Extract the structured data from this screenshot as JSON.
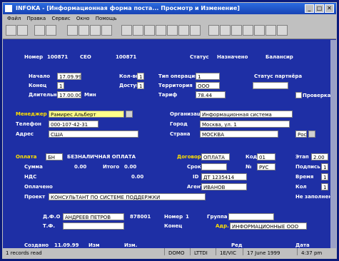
{
  "window": {
    "title": "INFOKA - [Информационная форма поста... Просмотр и Изменение]"
  },
  "menu": [
    "Файл",
    "Правка",
    "Сервис",
    "Окно",
    "Помощь"
  ],
  "header": {
    "label1": "Номер",
    "value1": "100871",
    "label2": "СЕО",
    "value2": "100871",
    "status_label": "Статус",
    "status_value": "Назначено",
    "right_label": "Балансир"
  },
  "form": {
    "left_labels": [
      "Начало",
      "Конец",
      "Длительность"
    ],
    "left_values": [
      "17.09.99",
      "1",
      "17.00.00"
    ],
    "unit": "Мин",
    "mid_labels": [
      "Кол-во",
      "Доступ"
    ],
    "mid_values": [
      "1",
      "1"
    ],
    "right_labels": [
      "Тип операции",
      "Территория",
      "Тариф"
    ],
    "right_values": [
      "1",
      "ООО",
      "78.44"
    ],
    "check_label": "Проверка",
    "status_right_label": "Статус партнёра",
    "manager_label": "Менеджер",
    "manager_value": "Рамирес Альберт",
    "tel_label": "Телефон",
    "tel_value": "000-107-42-31",
    "addr_label": "Адрес",
    "addr_value": "США",
    "org_label": "Организация",
    "org_value": "Информационная система",
    "addr2_label": "Город",
    "addr2_value": "Москва, ул. 1",
    "state_label": "Страна",
    "state_value": "МОСКВА",
    "country_value": "Россия"
  },
  "payment": {
    "label": "Оплата",
    "code": "БН",
    "desc": "БЕЗНАЛИЧНАЯ ОПЛАТА",
    "amount_label": "Сумма",
    "amount_value": "0.00",
    "sum2_label": "Итого",
    "sum2_value": "0.00",
    "total_value": "0.00",
    "vat_label": "НДС",
    "paid_label": "Оплачено",
    "project_label": "Проект",
    "project_value": "КОНСУЛЬТАНТ ПО СИСТЕМЕ ПОДДЕРЖКИ",
    "contract_label": "Договор",
    "contract_value": "ОПЛАТА",
    "term_label": "Срок",
    "id_label": "ID",
    "id_value": "ДТ 1235414",
    "agent_label": "Агент",
    "agent_value": "ИВАНОВ",
    "code_label": "Код",
    "code_value": "01",
    "num_label": "№",
    "num_value": "РУС",
    "r_labels": [
      "Этап",
      "Подпись",
      "Время",
      "Кол"
    ],
    "r_values": [
      "1",
      "1",
      "1",
      "1"
    ],
    "r_top_value": "2.00",
    "not_filled_label": "Не заполнено"
  },
  "contacts": {
    "l1": "Д.Ф.О",
    "v1": "АНДРЕЕВ ПЕТРОВ",
    "l2": "Т.Ф.",
    "num_value": "878001",
    "mid_label": "Номер",
    "mid_value": "1",
    "mid2_label": "Конец",
    "group_label": "Группа",
    "group_value": "",
    "adr_label": "Адр.",
    "adr_value": "ИНФОРМАЦИОННЫЕ ООО"
  },
  "footer": {
    "l1": "Создано",
    "v1": "11.09.99",
    "l2": "Изм",
    "l3": "Изм.",
    "l4": "Ред",
    "l5": "Дата"
  },
  "statusbar": {
    "left": "1 records read",
    "cells": [
      "DOMO",
      "LTTDI",
      "1E/VIC",
      "17 June 1999",
      "4:37 pm"
    ]
  },
  "colors": {
    "background": "#1e2fa5",
    "label_yellow": "#ffe000",
    "field_bg": "#ffffff"
  }
}
